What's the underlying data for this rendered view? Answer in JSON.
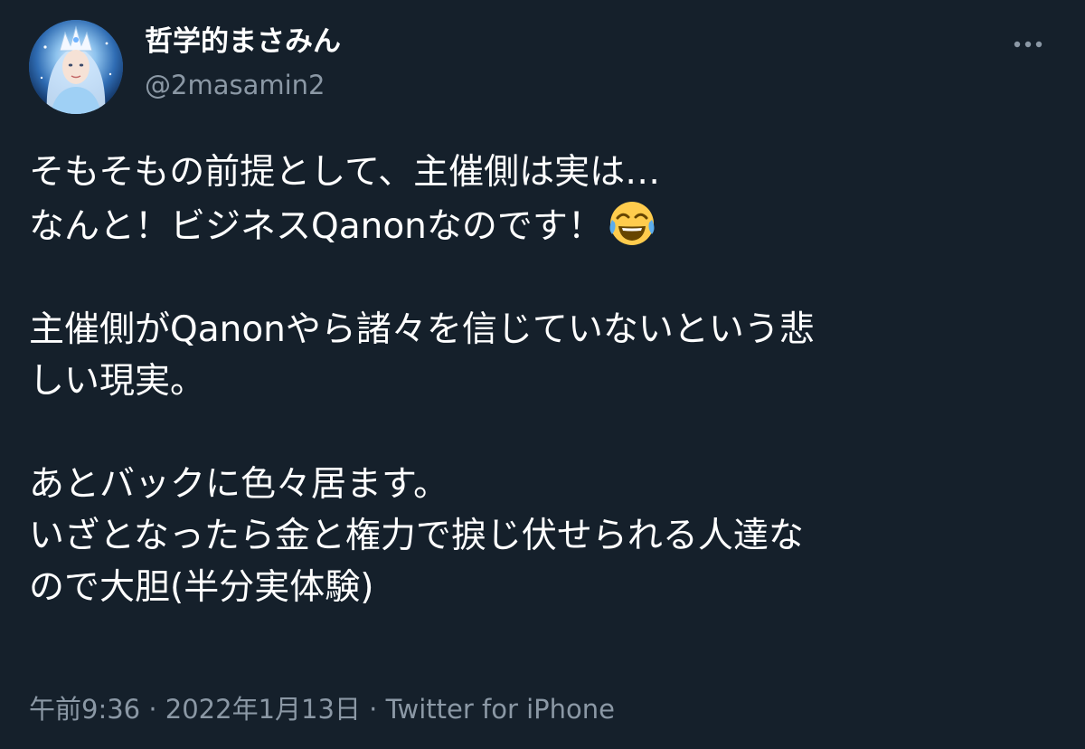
{
  "author": {
    "display_name": "哲学的まさみん",
    "handle": "@2masamin2",
    "avatar_icon": "avatar-image"
  },
  "menu": {
    "icon": "more-horizontal-icon"
  },
  "tweet": {
    "line1": "そもそもの前提として、主催側は実は…",
    "line2": "なんと！ビジネスQanonなのです！",
    "line2_emoji": "face-with-tears-of-joy-emoji",
    "line3": "主催側がQanonやら諸々を信じていないという悲",
    "line4": "しい現実。",
    "line5": "あとバックに色々居ます。",
    "line6": "いざとなったら金と権力で捩じ伏せられる人達な",
    "line7": "ので大胆(半分実体験)"
  },
  "meta": {
    "time": "午前9:36",
    "separator1": " · ",
    "date": "2022年1月13日",
    "separator2": " · ",
    "source": "Twitter for iPhone"
  },
  "colors": {
    "background": "#15202b",
    "primary_text": "#ffffff",
    "secondary_text": "#8b98a5"
  }
}
